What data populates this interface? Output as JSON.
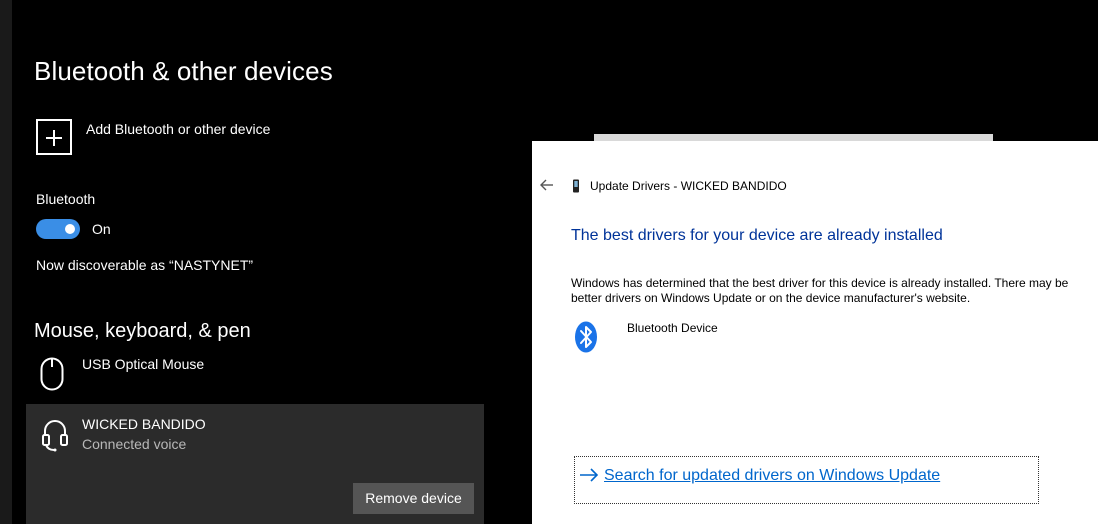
{
  "settings": {
    "title": "Bluetooth & other devices",
    "add_device_label": "Add Bluetooth or other device",
    "bluetooth_label": "Bluetooth",
    "toggle_state": "On",
    "discoverable_text": "Now discoverable as “NASTYNET”",
    "section_title": "Mouse, keyboard, & pen",
    "devices": [
      {
        "name": "USB Optical Mouse",
        "icon": "mouse-icon"
      },
      {
        "name": "WICKED BANDIDO",
        "status": "Connected voice",
        "icon": "headset-icon",
        "action": "Remove device"
      }
    ]
  },
  "dialog": {
    "title": "Update Drivers - WICKED BANDIDO",
    "heading": "The best drivers for your device are already installed",
    "body": "Windows has determined that the best driver for this device is already installed. There may be better drivers on Windows Update or on the device manufacturer's website.",
    "device_label": "Bluetooth Device",
    "link_text": "Search for updated drivers on Windows Update"
  },
  "colors": {
    "accent": "#3a8ee6",
    "dialog_heading": "#003399",
    "link": "#0066cc",
    "bluetooth_icon": "#1a73e8"
  }
}
